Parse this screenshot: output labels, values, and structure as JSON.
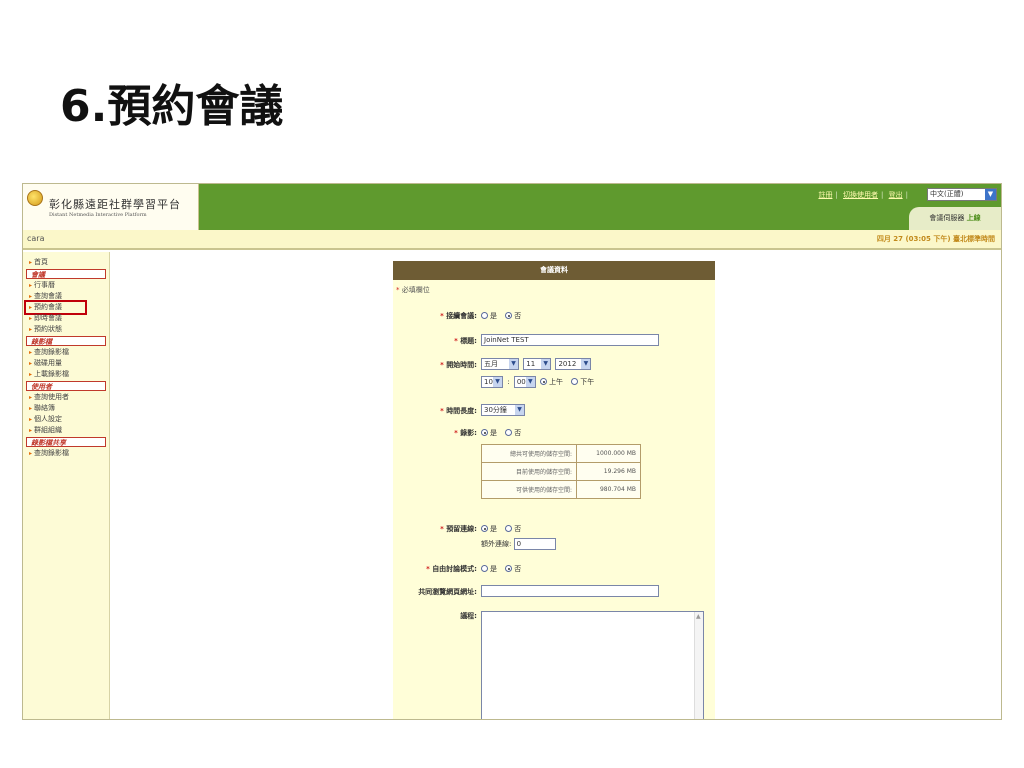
{
  "slide": {
    "title": "6.預約會議"
  },
  "header": {
    "logo_title": "彰化縣遠距社群學習平台",
    "logo_subtitle": "Distant Netmedia Interactive Platform",
    "links": [
      "註冊",
      "切換使用者",
      "登出"
    ],
    "language": "中文(正體)",
    "server_label": "會議伺服器",
    "server_status": "上線"
  },
  "info_bar": {
    "user": "cara",
    "clock": "四月 27 (03:05 下午) 臺北標準時間"
  },
  "sidebar": {
    "items": [
      {
        "label": "首頁",
        "type": "link"
      },
      {
        "label": "會議",
        "type": "group"
      },
      {
        "label": "行事曆",
        "type": "link"
      },
      {
        "label": "查詢會議",
        "type": "link"
      },
      {
        "label": "預約會議",
        "type": "link",
        "active": true
      },
      {
        "label": "即時會議",
        "type": "link"
      },
      {
        "label": "預約狀態",
        "type": "link"
      },
      {
        "label": "錄影檔",
        "type": "group"
      },
      {
        "label": "查詢錄影檔",
        "type": "link"
      },
      {
        "label": "磁碟用量",
        "type": "link"
      },
      {
        "label": "上載錄影檔",
        "type": "link"
      },
      {
        "label": "使用者",
        "type": "group"
      },
      {
        "label": "查詢使用者",
        "type": "link"
      },
      {
        "label": "聯絡簿",
        "type": "link"
      },
      {
        "label": "個人設定",
        "type": "link"
      },
      {
        "label": "群組組織",
        "type": "link"
      },
      {
        "label": "錄影檔共享",
        "type": "group"
      },
      {
        "label": "查詢錄影檔",
        "type": "link"
      }
    ]
  },
  "form": {
    "heading": "會議資料",
    "required_note": "必填欄位",
    "fields": {
      "password": {
        "label": "接續會議:",
        "yes": "是",
        "no": "否",
        "selected": "no"
      },
      "title": {
        "label": "標題:",
        "value": "JoinNet TEST"
      },
      "start_time": {
        "label": "開始時間:",
        "month": "五月",
        "day": "11",
        "year": "2012",
        "hour": "10",
        "minute": "00",
        "am": "上午",
        "pm": "下午",
        "selected": "am"
      },
      "duration": {
        "label": "時間長度:",
        "value": "30分鐘"
      },
      "record": {
        "label": "錄影:",
        "yes": "是",
        "no": "否",
        "selected": "yes",
        "storage": [
          {
            "key": "總共可使用的儲存空間:",
            "value": "1000.000 MB"
          },
          {
            "key": "目前使用的儲存空間:",
            "value": "19.296 MB"
          },
          {
            "key": "可供使用的儲存空間:",
            "value": "980.704 MB"
          }
        ]
      },
      "reserve": {
        "label": "預留連線:",
        "yes": "是",
        "no": "否",
        "selected": "yes",
        "extra_label": "額外連線:",
        "extra_value": "0"
      },
      "free_mode": {
        "label": "自由討論模式:",
        "yes": "是",
        "no": "否",
        "selected": "no"
      },
      "share_url": {
        "label": "共同瀏覽網頁網址:",
        "value": ""
      },
      "agenda": {
        "label": "議程:",
        "value": ""
      }
    }
  }
}
